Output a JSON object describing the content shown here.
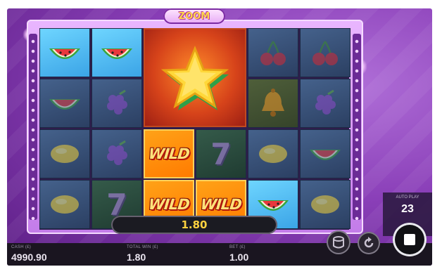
{
  "game": {
    "logo": "ZOOM",
    "last_win": "1.80"
  },
  "reels": {
    "symbols": [
      [
        "watermelon",
        "watermelon",
        "star",
        "star",
        "cherry",
        "cherry"
      ],
      [
        "watermelon",
        "grape",
        "star",
        "star",
        "bell",
        "grape"
      ],
      [
        "lemon",
        "grape",
        "wild",
        "7",
        "lemon",
        "watermelon"
      ],
      [
        "lemon",
        "7",
        "wild",
        "wild",
        "watermelon",
        "lemon"
      ]
    ],
    "wild_text": "WILD",
    "seven_text": "7"
  },
  "autoplay": {
    "label": "AUTO PLAY",
    "count": "23"
  },
  "bottom_bar": {
    "cash_label": "CASH (£)",
    "cash_value": "4990.90",
    "total_win_label": "TOTAL WIN (£)",
    "total_win_value": "1.80",
    "bet_label": "BET (£)",
    "bet_value": "1.00"
  },
  "colors": {
    "background": "#8a3fb8",
    "win_text": "#ffd23f",
    "wild_bg": "#ff8a00"
  },
  "icons": [
    "coin-stack-icon",
    "replay-icon",
    "stop-icon",
    "watermelon-icon",
    "cherry-icon",
    "star-icon",
    "grape-icon",
    "bell-icon",
    "lemon-icon"
  ]
}
